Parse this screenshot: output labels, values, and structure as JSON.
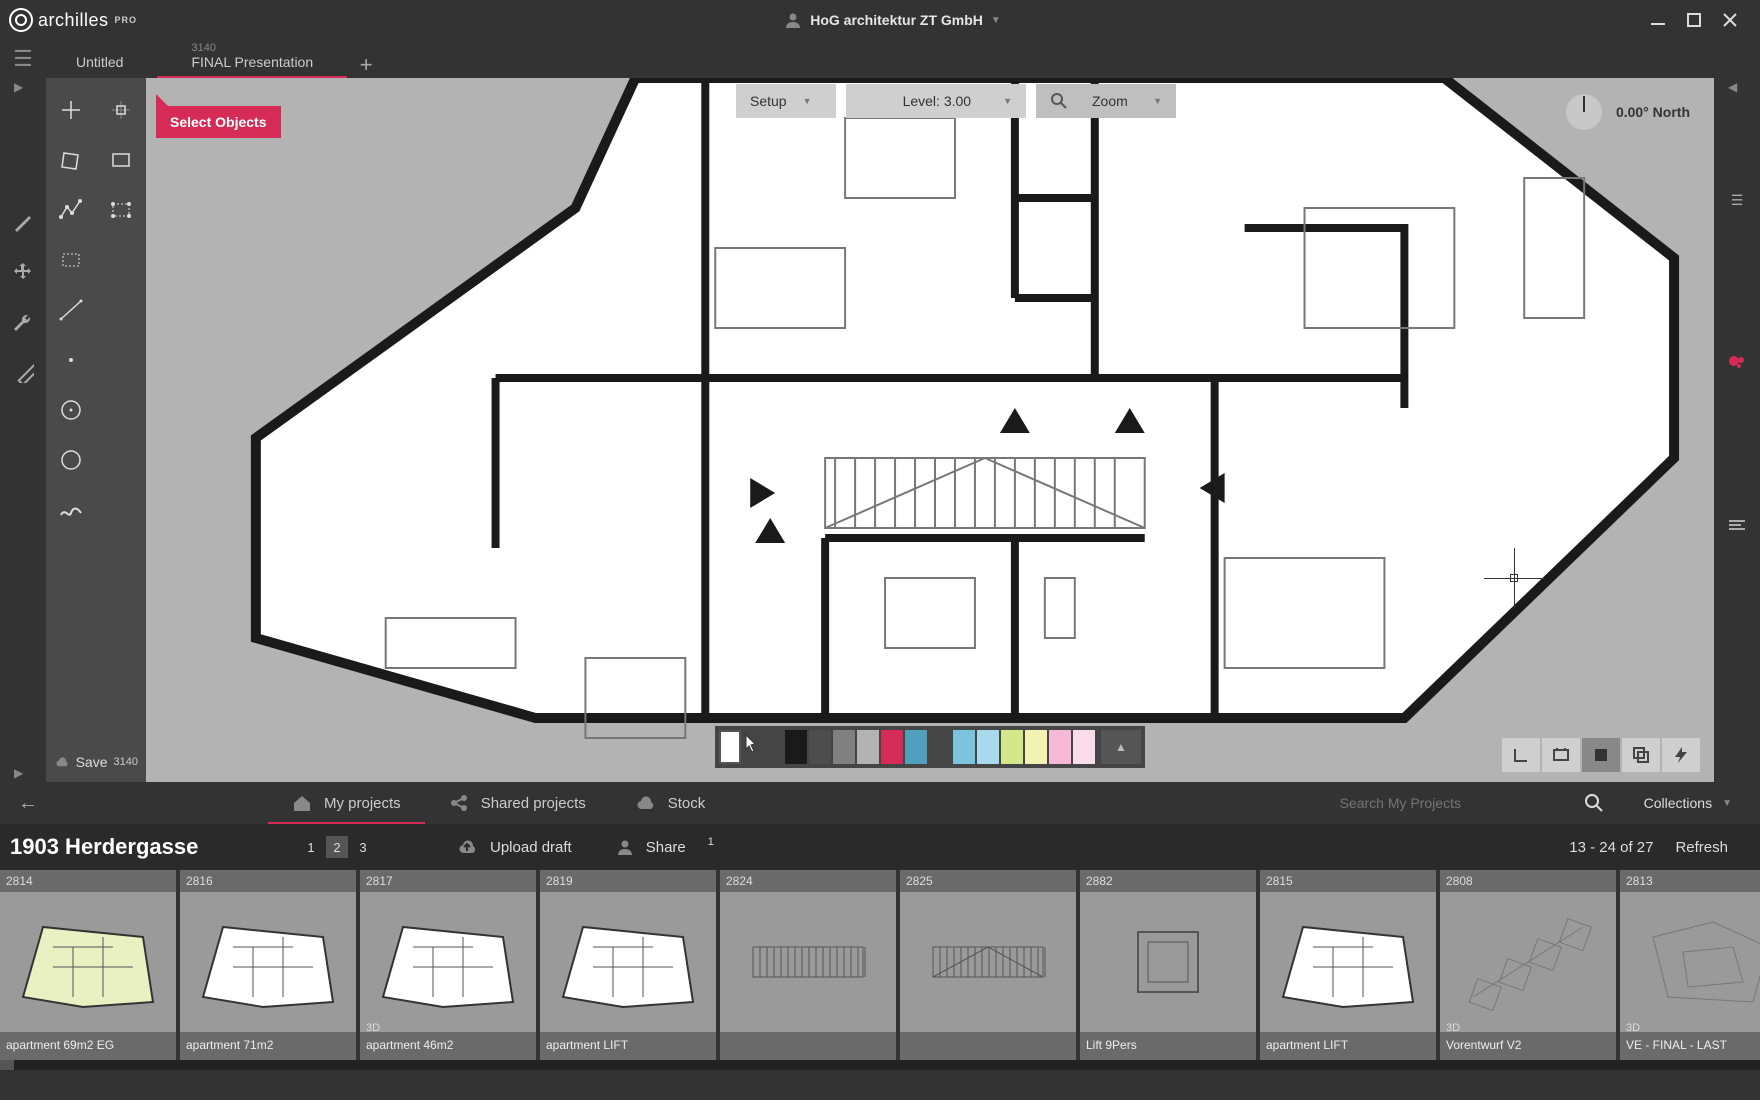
{
  "app": {
    "brand": "archilles",
    "edition": "PRO",
    "company": "HoG architektur ZT GmbH"
  },
  "tabs": [
    {
      "id": "",
      "label": "Untitled",
      "active": false
    },
    {
      "id": "3140",
      "label": "FINAL Presentation",
      "active": true
    }
  ],
  "selectTag": "Select Objects",
  "canvasControls": {
    "setup": "Setup",
    "levelLabel": "Level: 3.00",
    "zoom": "Zoom",
    "compass": "0.00° North"
  },
  "save": {
    "label": "Save",
    "id": "3140"
  },
  "palette": [
    "#ffffff",
    "#1a1a1a",
    "#4d4d4d",
    "#808080",
    "#b3b3b3",
    "#d52b56",
    "#4fa0bd",
    "#7cc3e0",
    "#a9d9ec",
    "#d4e88a",
    "#f2f2b3",
    "#f5b8d6",
    "#fadceb"
  ],
  "projNav": {
    "myProjects": "My projects",
    "sharedProjects": "Shared projects",
    "stock": "Stock",
    "searchPlaceholder": "Search My Projects",
    "collections": "Collections"
  },
  "projTool": {
    "title": "1903 Herdergasse",
    "pages": [
      "1",
      "2",
      "3"
    ],
    "activePage": 1,
    "upload": "Upload draft",
    "share": "Share",
    "shareCount": "1",
    "range": "13 - 24 of 27",
    "refresh": "Refresh"
  },
  "thumbs": [
    {
      "id": "2814",
      "label": "apartment 69m2 EG",
      "is3d": false,
      "tint": "#e9f0c2"
    },
    {
      "id": "2816",
      "label": "apartment 71m2",
      "is3d": false,
      "tint": "#ffffff"
    },
    {
      "id": "2817",
      "label": "apartment 46m2",
      "is3d": true,
      "tint": "#ffffff"
    },
    {
      "id": "2819",
      "label": "apartment LIFT",
      "is3d": false,
      "tint": "#ffffff"
    },
    {
      "id": "2824",
      "label": "",
      "is3d": false,
      "tint": "#9a9a9a"
    },
    {
      "id": "2825",
      "label": "",
      "is3d": false,
      "tint": "#9a9a9a"
    },
    {
      "id": "2882",
      "label": "Lift 9Pers",
      "is3d": false,
      "tint": "#9a9a9a"
    },
    {
      "id": "2815",
      "label": "apartment LIFT",
      "is3d": false,
      "tint": "#ffffff"
    },
    {
      "id": "2808",
      "label": "Vorentwurf V2",
      "is3d": true,
      "tint": "#eeeeee"
    },
    {
      "id": "2813",
      "label": "VE - FINAL - LAST",
      "is3d": true,
      "tint": "#eeeeee"
    }
  ]
}
